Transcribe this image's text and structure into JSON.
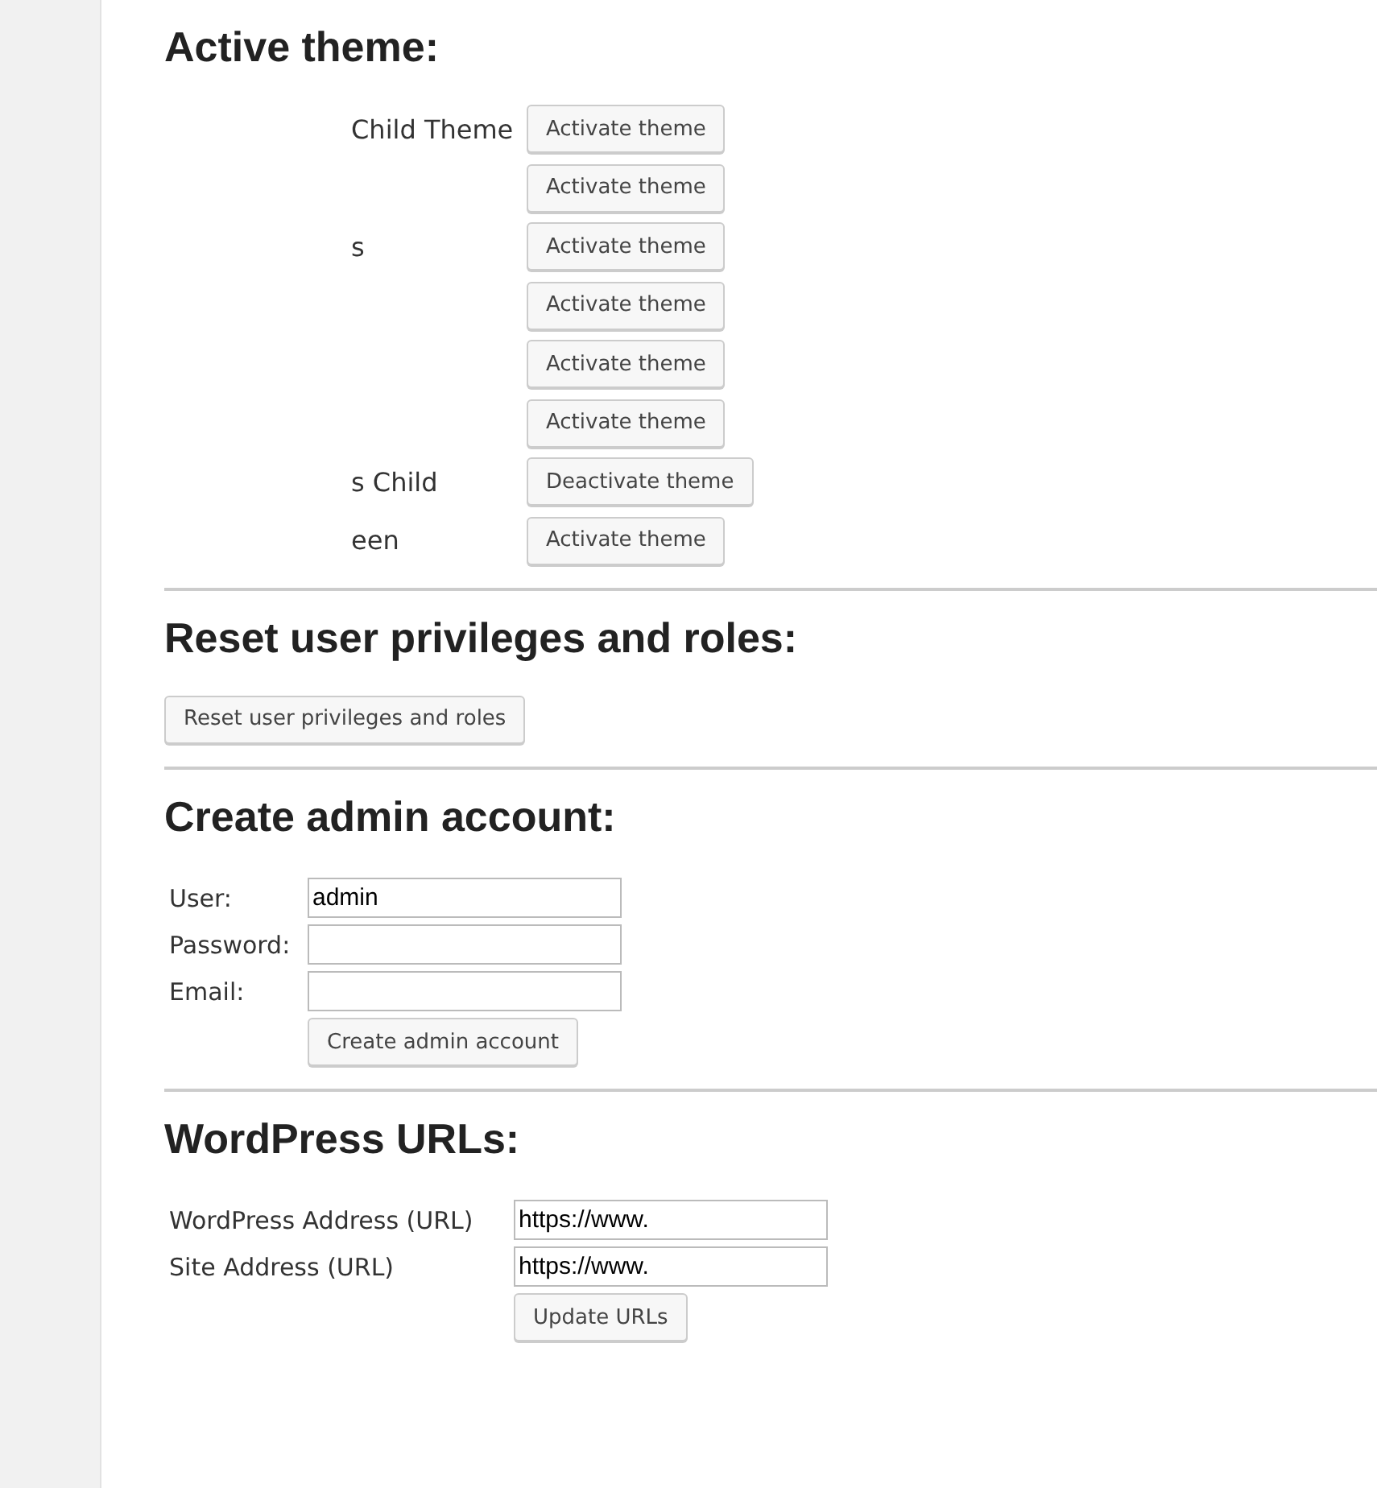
{
  "sections": [
    {
      "kind": "themes",
      "title": "Active theme:",
      "themes": [
        {
          "name": "Child Theme",
          "button": "Activate theme"
        },
        {
          "button": "Activate theme"
        },
        {
          "name": "s",
          "button": "Activate theme"
        },
        {
          "button": "Activate theme"
        },
        {
          "button": "Activate theme"
        },
        {
          "button": "Activate theme"
        },
        {
          "name": "s Child",
          "button": "Deactivate theme"
        },
        {
          "name": "een",
          "button": "Activate theme"
        }
      ]
    },
    {
      "kind": "action",
      "title": "Reset user privileges and roles:",
      "button": "Reset user privileges and roles"
    },
    {
      "kind": "form",
      "title": "Create admin account:",
      "fields": [
        {
          "label": "User:",
          "value": "admin"
        },
        {
          "label": "Password:"
        },
        {
          "label": "Email:"
        }
      ],
      "button": "Create admin account"
    },
    {
      "kind": "form",
      "title": "WordPress URLs:",
      "fields": [
        {
          "label": "WordPress Address (URL)",
          "value": "https://www."
        },
        {
          "label": "Site Address (URL)",
          "value": "https://www."
        }
      ],
      "button": "Update URLs"
    }
  ]
}
